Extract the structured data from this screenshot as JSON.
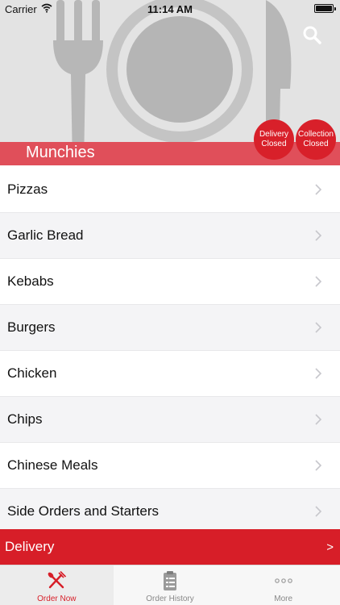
{
  "status_bar": {
    "carrier": "Carrier",
    "time": "11:14 AM"
  },
  "header": {
    "restaurant_name": "Munchies",
    "badges": {
      "delivery": {
        "line1": "Delivery",
        "line2": "Closed"
      },
      "collection": {
        "line1": "Collection",
        "line2": "Closed"
      }
    }
  },
  "menu": {
    "items": [
      "Pizzas",
      "Garlic Bread",
      "Kebabs",
      "Burgers",
      "Chicken",
      "Chips",
      "Chinese Meals",
      "Side Orders and Starters"
    ]
  },
  "delivery_bar": {
    "label": "Delivery",
    "arrow": ">"
  },
  "tab_bar": {
    "tabs": [
      {
        "label": "Order Now",
        "icon": "fork-knife-icon"
      },
      {
        "label": "Order History",
        "icon": "clipboard-icon"
      },
      {
        "label": "More",
        "icon": "more-dots-icon"
      }
    ]
  },
  "colors": {
    "accent": "#d71e28",
    "band": "#e04f5a",
    "hero_bg": "#e3e3e3"
  }
}
